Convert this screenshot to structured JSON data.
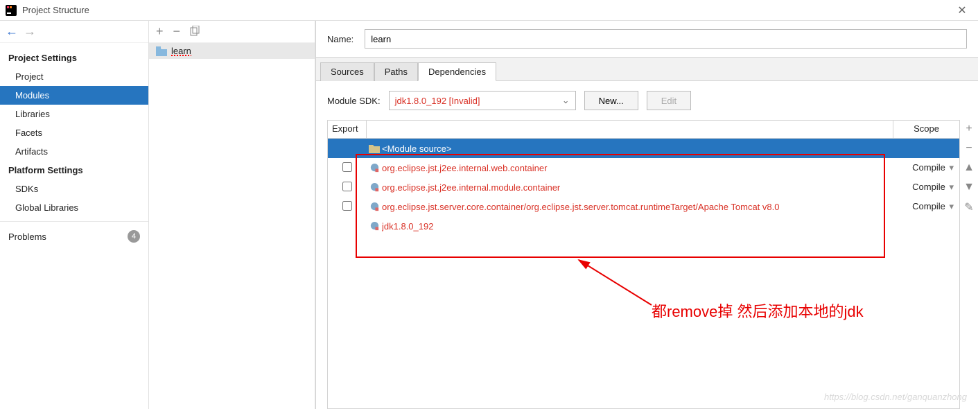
{
  "window": {
    "title": "Project Structure"
  },
  "sidebar": {
    "section1": {
      "heading": "Project Settings",
      "items": [
        "Project",
        "Modules",
        "Libraries",
        "Facets",
        "Artifacts"
      ],
      "selected": 1
    },
    "section2": {
      "heading": "Platform Settings",
      "items": [
        "SDKs",
        "Global Libraries"
      ]
    },
    "problems": {
      "label": "Problems",
      "count": "4"
    }
  },
  "tree": {
    "module_name": "learn"
  },
  "content": {
    "name_label": "Name:",
    "name_value": "learn",
    "tabs": [
      "Sources",
      "Paths",
      "Dependencies"
    ],
    "active_tab": 2,
    "sdk_label": "Module SDK:",
    "sdk_value": "jdk1.8.0_192 [Invalid]",
    "new_btn": "New...",
    "edit_btn": "Edit",
    "header": {
      "export": "Export",
      "scope": "Scope"
    },
    "deps": [
      {
        "type": "module",
        "name": "<Module source>",
        "scope": ""
      },
      {
        "type": "lib",
        "name": "org.eclipse.jst.j2ee.internal.web.container",
        "scope": "Compile",
        "checkbox": true
      },
      {
        "type": "lib",
        "name": "org.eclipse.jst.j2ee.internal.module.container",
        "scope": "Compile",
        "checkbox": true
      },
      {
        "type": "lib",
        "name": "org.eclipse.jst.server.core.container/org.eclipse.jst.server.tomcat.runtimeTarget/Apache Tomcat v8.0",
        "scope": "Compile",
        "checkbox": true
      },
      {
        "type": "lib",
        "name": "jdk1.8.0_192",
        "scope": ""
      }
    ]
  },
  "annotation": {
    "text": "都remove掉  然后添加本地的jdk"
  },
  "watermark": "https://blog.csdn.net/ganquanzhong"
}
